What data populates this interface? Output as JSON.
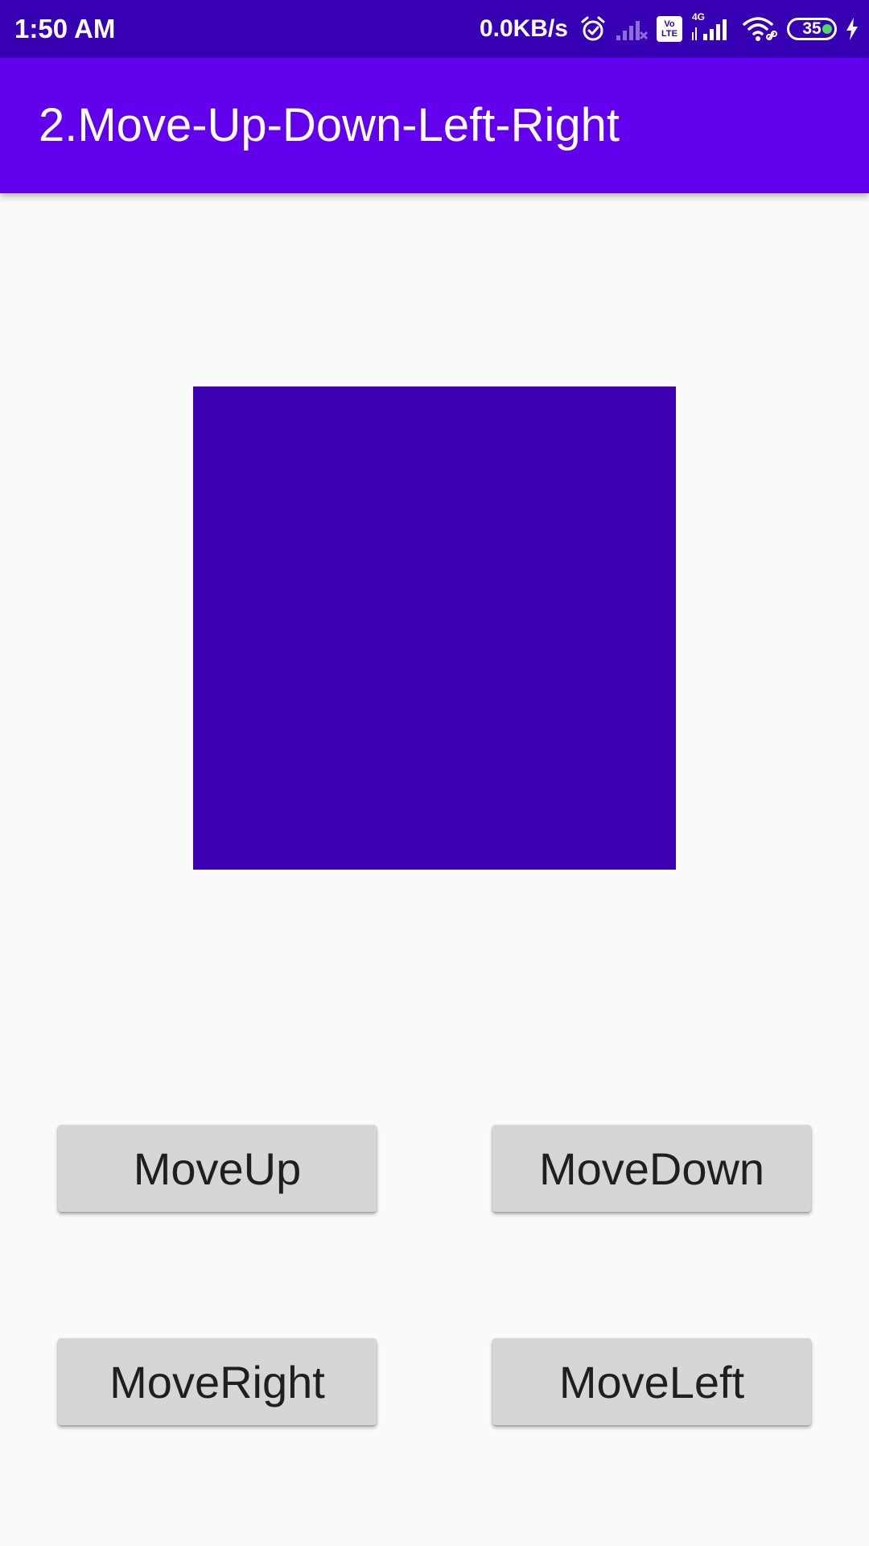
{
  "status_bar": {
    "time": "1:50 AM",
    "net_speed": "0.0KB/s",
    "network_type": "4G",
    "volte_line1": "Vo",
    "volte_line2": "LTE",
    "battery_level": "35",
    "icons": [
      "alarm-icon",
      "no-signal-icon",
      "volte-icon",
      "signal-4g-icon",
      "wifi-icon",
      "battery-icon",
      "charging-icon"
    ]
  },
  "app_bar": {
    "title": "2.Move-Up-Down-Left-Right"
  },
  "canvas": {
    "square_color": "#3a00b1"
  },
  "buttons": {
    "move_up": "MoveUp",
    "move_down": "MoveDown",
    "move_right": "MoveRight",
    "move_left": "MoveLeft"
  },
  "colors": {
    "status_bar": "#3700b3",
    "app_bar": "#6200ee",
    "background": "#fafafa",
    "button_bg": "#d6d6d6",
    "button_text": "#1f1f1f"
  }
}
